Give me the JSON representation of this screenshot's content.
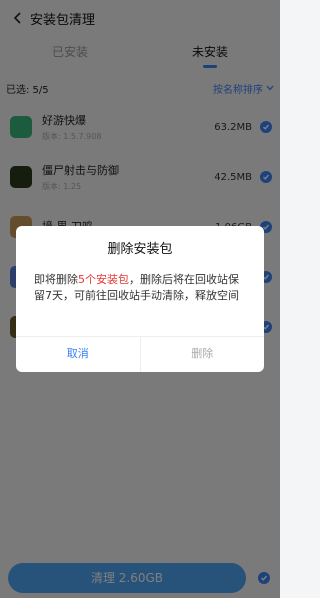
{
  "header": {
    "title": "安装包清理"
  },
  "tabs": [
    {
      "label": "已安装"
    },
    {
      "label": "未安装"
    }
  ],
  "selection": {
    "summary": "已选: 5/5",
    "sort_label": "按名称排序"
  },
  "apps": [
    {
      "name": "好游快爆",
      "version": "版本: 1.5.7.908",
      "size": "63.2MB",
      "icon_color": "#3bb77e"
    },
    {
      "name": "僵尸射击与防御",
      "version": "版本: 1.25",
      "size": "42.5MB",
      "icon_color": "#2b3b1f"
    },
    {
      "name": "境·界 刀鸣",
      "version": "",
      "size": "1.06GB",
      "icon_color": "#c69a5a"
    },
    {
      "name": "",
      "version": "",
      "size": "",
      "icon_color": "#5a7bd8"
    },
    {
      "name": "",
      "version": "",
      "size": "",
      "icon_color": "#6b5b2a"
    }
  ],
  "dialog": {
    "title": "删除安装包",
    "message_pre": "即将删除",
    "message_highlight": "5个安装包",
    "message_post": "，删除后将在回收站保留7天，可前往回收站手动清除，释放空间",
    "cancel": "取消",
    "confirm": "删除"
  },
  "bottom": {
    "button_label": "清理 2.60GB"
  },
  "colors": {
    "accent": "#3b82f6",
    "highlight": "#e53935"
  }
}
